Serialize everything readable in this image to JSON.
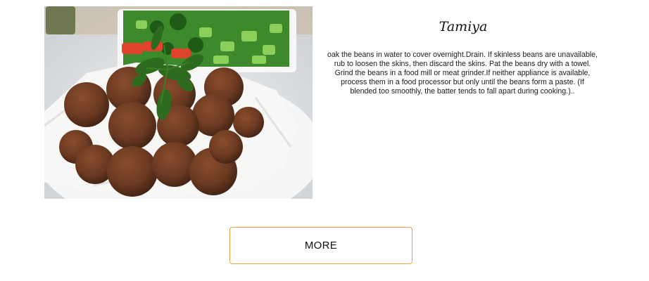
{
  "recipe": {
    "title": "Tamiya",
    "description": "oak the beans in water to cover overnight.Drain. If skinless beans are unavailable, rub to loosen the skins, then discard the skins. Pat the beans dry with a towel. Grind the beans in a food mill or meat grinder.If neither appliance is available, process them in a food processor but only until the beans form a paste. (If blended too smoothly, the batter tends to fall apart during cooking.)..",
    "image_subject": "falafel-plate-photo"
  },
  "actions": {
    "more_label": "MORE"
  },
  "colors": {
    "button_border": "#f0a04b",
    "falafel": "#6b3a22",
    "parsley": "#2f6b1f"
  }
}
